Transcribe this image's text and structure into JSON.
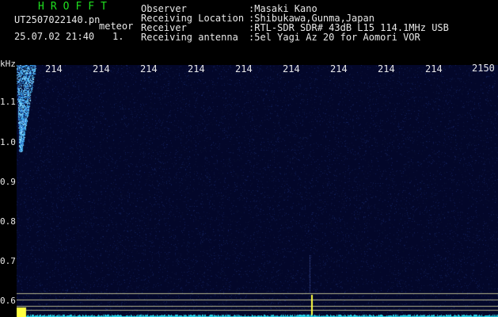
{
  "header": {
    "logo": "HROFFT",
    "file_name": "UT2507022140.pn",
    "meteor_tag": "meteor",
    "date_time": "25.07.02 21:40",
    "index": "1.",
    "info": [
      {
        "label": "Observer",
        "value": ":Masaki Kano"
      },
      {
        "label": "Receiving Location",
        "value": ":Shibukawa,Gunma,Japan"
      },
      {
        "label": "Receiver",
        "value": ":RTL-SDR SDR# 43dB L15 114.1MHz USB"
      },
      {
        "label": "Receiving antenna",
        "value": ":5el Yagi Az 20 for Aomori VOR"
      }
    ]
  },
  "axis": {
    "y_unit": "kHz",
    "y_ticks": [
      "1.1",
      "1.0",
      "0.9",
      "0.8",
      "0.7",
      "0.6"
    ],
    "x_ticks": [
      "214",
      "214",
      "214",
      "214",
      "214",
      "214",
      "214",
      "214",
      "214"
    ],
    "x_last": "2150"
  },
  "colors": {
    "background": "#000000",
    "waterfall": "#03072a",
    "text": "#e8e8e8",
    "logo": "#1fe01f",
    "signal": "#ffff40"
  }
}
